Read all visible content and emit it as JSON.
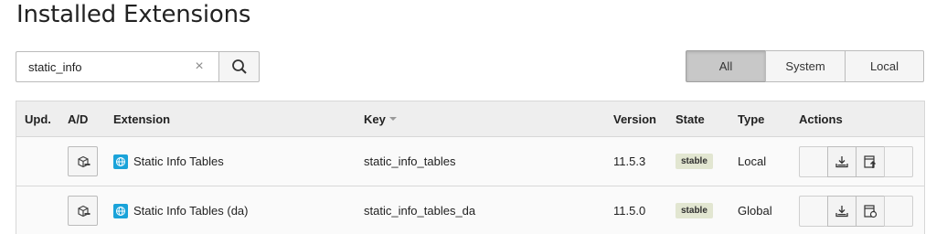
{
  "page": {
    "title": "Installed Extensions"
  },
  "search": {
    "value": "static_info",
    "clear_icon": "close-icon",
    "button_icon": "search-icon"
  },
  "filters": [
    {
      "label": "All",
      "active": true
    },
    {
      "label": "System",
      "active": false
    },
    {
      "label": "Local",
      "active": false
    }
  ],
  "table": {
    "headers": {
      "upd": "Upd.",
      "ad": "A/D",
      "extension": "Extension",
      "key": "Key",
      "version": "Version",
      "state": "State",
      "type": "Type",
      "actions": "Actions"
    },
    "rows": [
      {
        "extension": "Static Info Tables",
        "key": "static_info_tables",
        "version": "11.5.3",
        "state": "stable",
        "type": "Local",
        "action_icons": [
          "download-icon",
          "upload-icon"
        ]
      },
      {
        "extension": "Static Info Tables (da)",
        "key": "static_info_tables_da",
        "version": "11.5.0",
        "state": "stable",
        "type": "Global",
        "action_icons": [
          "download-icon",
          "reload-icon"
        ]
      }
    ]
  },
  "colors": {
    "accent": "#1aa3d9",
    "badge_bg": "#e2e6d1",
    "active_filter": "#c8c8c8"
  }
}
